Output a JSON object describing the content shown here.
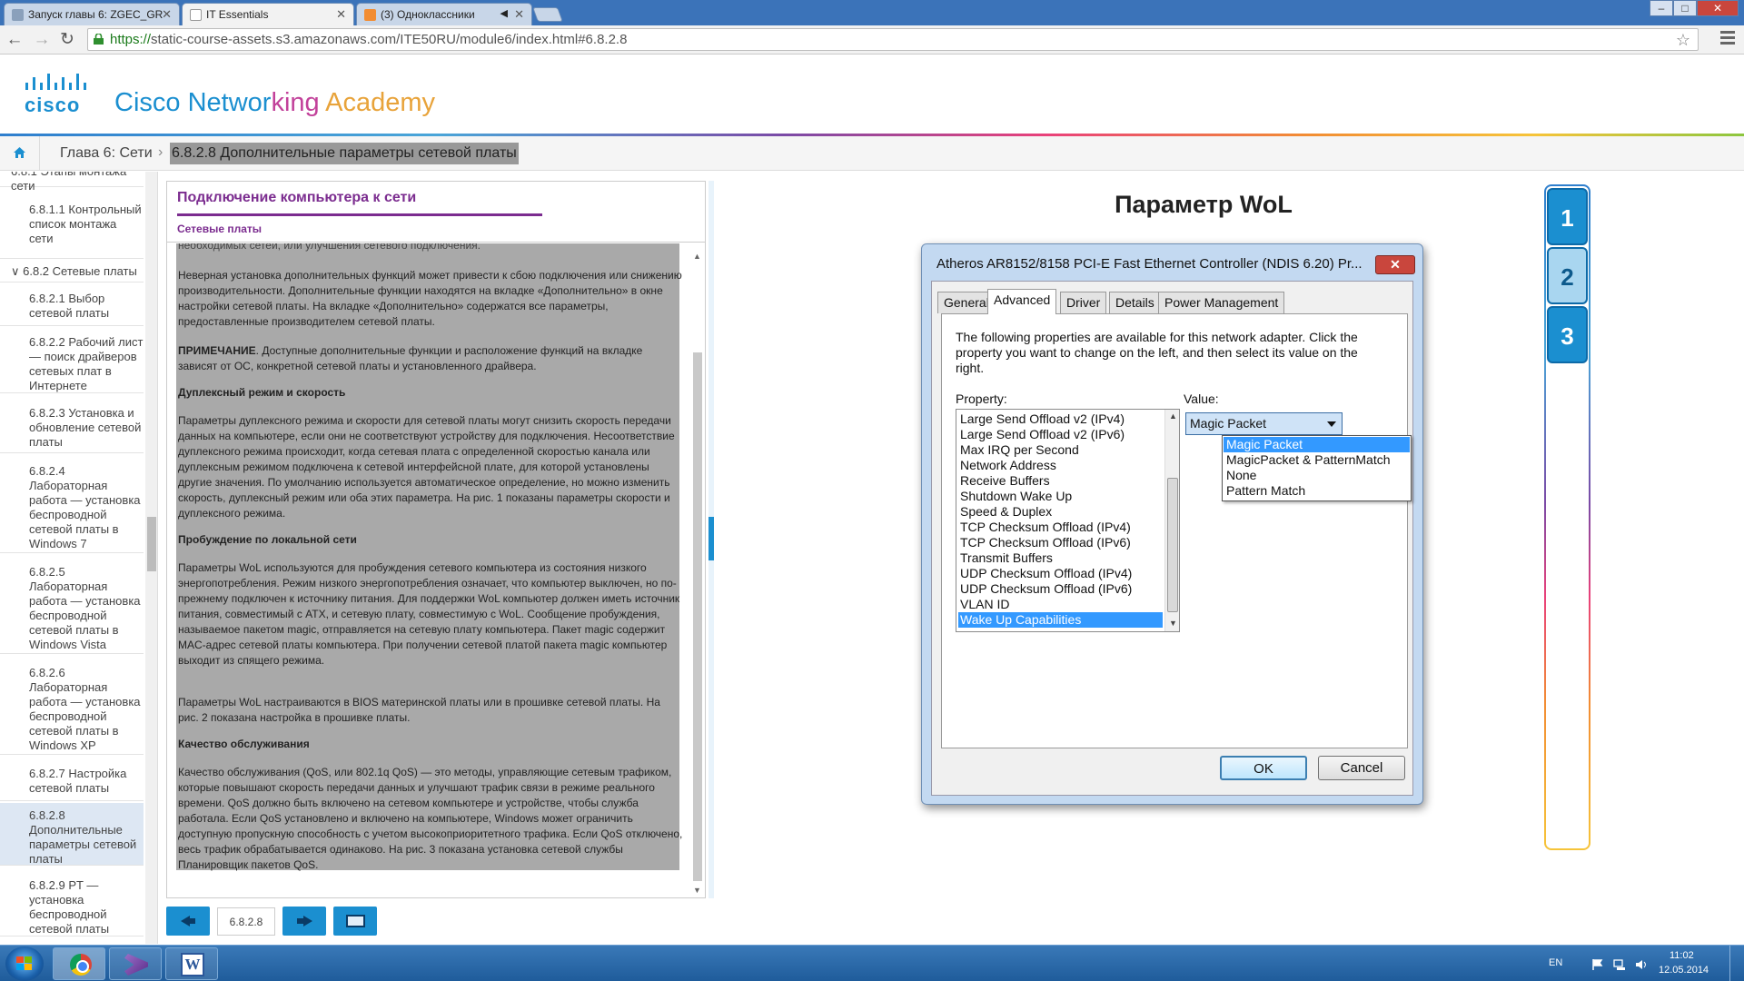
{
  "browser": {
    "tabs": [
      {
        "title": "Запуск главы 6: ZGEC_GR",
        "active": false
      },
      {
        "title": "IT Essentials",
        "active": true
      },
      {
        "title": "(3) Одноклассники",
        "active": false
      }
    ],
    "url_scheme": "https://",
    "url_rest": "static-course-assets.s3.amazonaws.com/ITE50RU/module6/index.html#6.8.2.8"
  },
  "header": {
    "logo_text": "cisco",
    "brand_parts": [
      {
        "text": "Cisco Networ",
        "color": "#1b8fd0"
      },
      {
        "text": "king",
        "color": "#c2419a"
      },
      {
        "text": " ",
        "color": "#1b8fd0"
      },
      {
        "text": "Academy",
        "color": "#e8a33a"
      }
    ]
  },
  "breadcrumb": {
    "chapter": "Глава 6: Сети",
    "separator": "›",
    "current": "6.8.2.8 Дополнительные параметры сетевой платы"
  },
  "leftnav": {
    "items": [
      {
        "label": "6.8.1 Этапы монтажа сети",
        "section": true
      },
      {
        "label": "6.8.1.1 Контрольный список монтажа сети"
      },
      {
        "label": "∨ 6.8.2 Сетевые платы",
        "section": true
      },
      {
        "label": "6.8.2.1 Выбор сетевой платы"
      },
      {
        "label": "6.8.2.2 Рабочий лист — поиск драйверов сетевых плат в Интернете"
      },
      {
        "label": "6.8.2.3 Установка и обновление сетевой платы"
      },
      {
        "label": "6.8.2.4 Лабораторная работа — установка беспроводной сетевой платы в Windows 7"
      },
      {
        "label": "6.8.2.5 Лабораторная работа — установка беспроводной сетевой платы в Windows Vista"
      },
      {
        "label": "6.8.2.6 Лабораторная работа — установка беспроводной сетевой платы в Windows XP"
      },
      {
        "label": "6.8.2.7 Настройка сетевой платы"
      },
      {
        "label": "6.8.2.8 Дополнительные параметры сетевой платы",
        "active": true
      },
      {
        "label": "6.8.2.9 PT — установка беспроводной сетевой платы"
      }
    ]
  },
  "textpanel": {
    "title": "Подключение компьютера к сети",
    "subtitle": "Сетевые платы",
    "paragraphs": [
      {
        "text": "необходимых сетей, или улучшения сетевого подключения."
      },
      {
        "text": "Неверная установка дополнительных функций может привести к сбою подключения или снижению производительности. Дополнительные функции находятся на вкладке «Дополнительно» в окне настройки сетевой платы. На вкладке «Дополнительно» содержатся все параметры, предоставленные производителем сетевой платы."
      },
      {
        "text_bold": "ПРИМЕЧАНИЕ",
        "text": ". Доступные дополнительные функции и расположение функций на вкладке зависят от ОС, конкретной сетевой платы и установленного драйвера."
      },
      {
        "text": "Дуплексный режим и скорость",
        "heading": true
      },
      {
        "text": "Параметры дуплексного режима и скорости для сетевой платы могут снизить скорость передачи данных на компьютере, если они не соответствуют устройству для подключения. Несоответствие дуплексного режима происходит, когда сетевая плата с определенной скоростью канала или дуплексным режимом подключена к сетевой интерфейсной плате, для которой установлены другие значения. По умолчанию используется автоматическое определение, но можно изменить скорость, дуплексный режим или оба этих параметра. На рис. 1 показаны параметры скорости и дуплексного режима."
      },
      {
        "text": "Пробуждение по локальной сети",
        "heading": true
      },
      {
        "text": "Параметры WoL используются для пробуждения сетевого компьютера из состояния низкого энергопотребления. Режим низкого энергопотребления означает, что компьютер выключен, но по-прежнему подключен к источнику питания. Для поддержки WoL компьютер должен иметь источник питания, совместимый с ATX, и сетевую плату, совместимую с WoL. Сообщение пробуждения, называемое пакетом magic, отправляется на сетевую плату компьютера. Пакет magic содержит MAC-адрес сетевой платы компьютера. При получении сетевой платой пакета magic компьютер выходит из спящего режима."
      },
      {
        "text": "Параметры WoL настраиваются в BIOS материнской платы или в прошивке сетевой платы. На рис. 2 показана настройка в прошивке платы."
      },
      {
        "text": "Качество обслуживания",
        "heading": true
      },
      {
        "text": "Качество обслуживания (QoS, или 802.1q QoS) — это методы, управляющие сетевым трафиком, которые повышают скорость передачи данных и улучшают трафик связи в режиме реального времени. QoS должно быть включено на сетевом компьютере и устройстве, чтобы служба работала. Если QoS установлено и включено на компьютере, Windows может ограничить доступную пропускную способность с учетом высокоприоритетного трафика. Если QoS отключено, весь трафик обрабатывается одинаково. На рис. 3 показана установка сетевой службы Планировщик пакетов QoS."
      }
    ]
  },
  "pager": {
    "page_number": "6.8.2.8"
  },
  "figure": {
    "title": "Параметр WoL",
    "dialog": {
      "title": "Atheros AR8152/8158 PCI-E Fast Ethernet Controller (NDIS 6.20) Pr...",
      "close": "✕",
      "tabs": [
        "General",
        "Advanced",
        "Driver",
        "Details",
        "Power Management"
      ],
      "active_tab": "Advanced",
      "description": "The following properties are available for this network adapter. Click the property you want to change on the left, and then select its value on the right.",
      "property_label": "Property:",
      "value_label": "Value:",
      "properties": [
        "Large Send Offload v2 (IPv4)",
        "Large Send Offload v2 (IPv6)",
        "Max IRQ per Second",
        "Network Address",
        "Receive Buffers",
        "Shutdown Wake Up",
        "Speed & Duplex",
        "TCP Checksum Offload (IPv4)",
        "TCP Checksum Offload (IPv6)",
        "Transmit Buffers",
        "UDP Checksum Offload (IPv4)",
        "UDP Checksum Offload (IPv6)",
        "VLAN ID",
        "Wake Up Capabilities"
      ],
      "selected_property": "Wake Up Capabilities",
      "value": "Magic Packet",
      "value_options": [
        "Magic Packet",
        "MagicPacket & PatternMatch",
        "None",
        "Pattern Match"
      ],
      "selected_option": "Magic Packet",
      "ok": "OK",
      "cancel": "Cancel"
    },
    "selector": [
      "1",
      "2",
      "3"
    ],
    "active_figure": "2"
  },
  "taskbar": {
    "language": "EN",
    "time": "11:02",
    "date": "12.05.2014"
  }
}
